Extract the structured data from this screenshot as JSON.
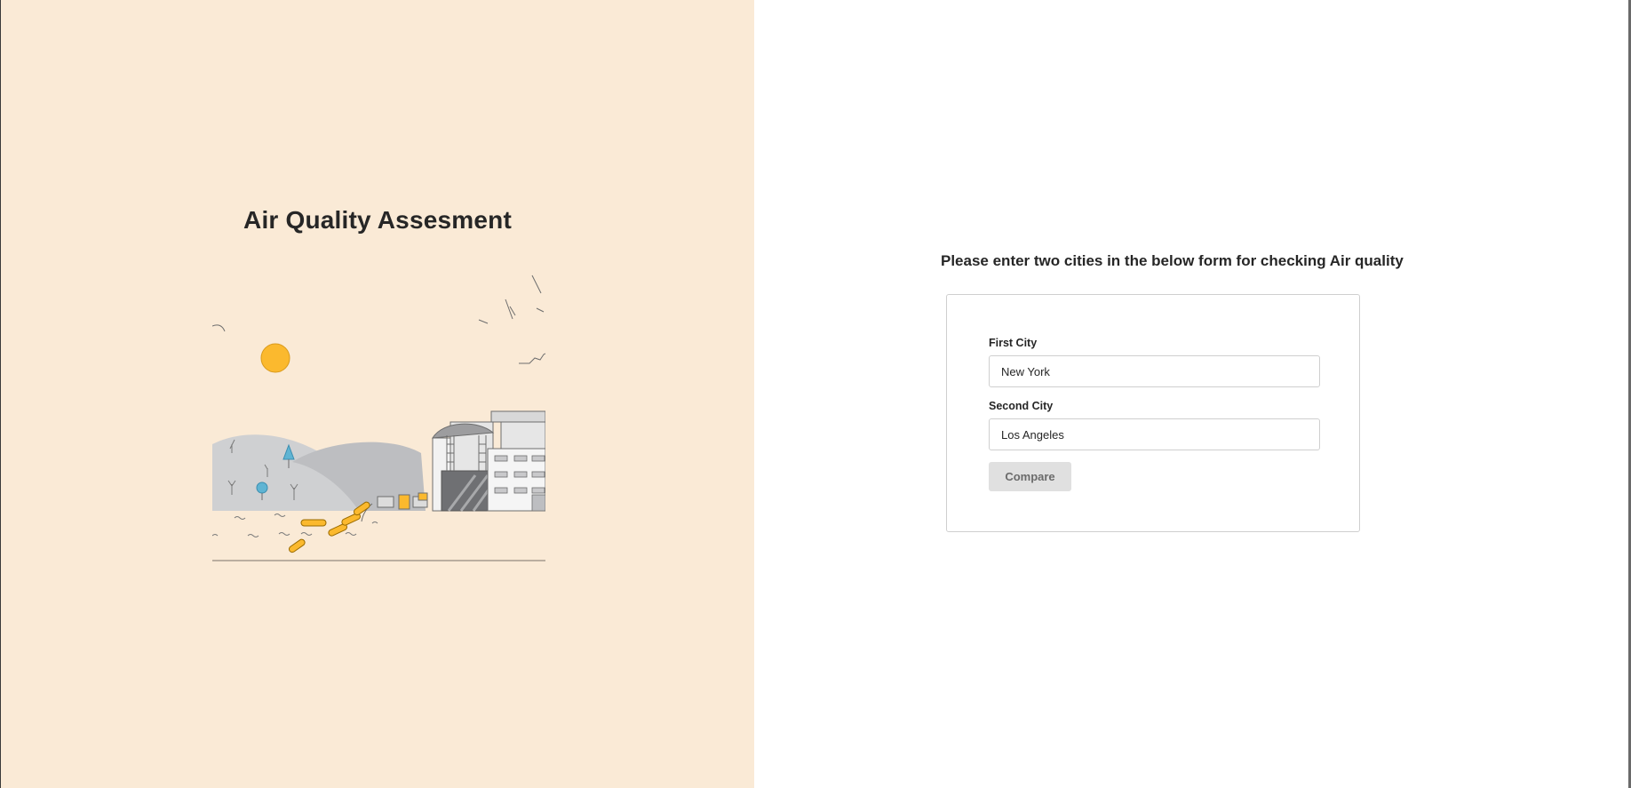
{
  "hero": {
    "title": "Air Quality Assesment"
  },
  "form": {
    "heading": "Please enter two cities in the below form for checking Air quality",
    "first_city_label": "First City",
    "first_city_value": "New York",
    "second_city_label": "Second City",
    "second_city_value": "Los Angeles",
    "submit_label": "Compare"
  },
  "colors": {
    "left_panel_bg": "#faead6",
    "sun": "#fbb92e",
    "button_bg": "#e0e0e0",
    "text": "#262626"
  }
}
